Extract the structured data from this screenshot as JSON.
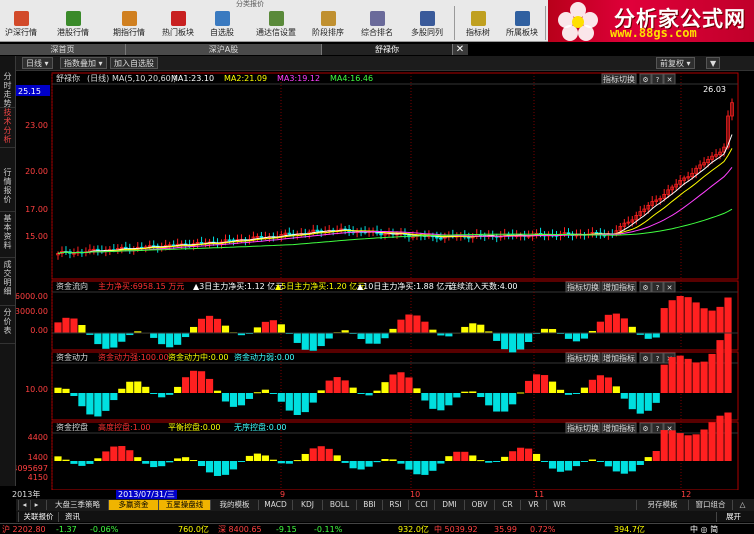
{
  "section_title": "分类报价",
  "toolbar": [
    {
      "label": "沪深行情",
      "color": "#d24a2a"
    },
    {
      "label": "港股行情",
      "color": "#3a8a2a"
    },
    {
      "label": "期指行情",
      "color": "#d08020"
    },
    {
      "label": "热门板块",
      "color": "#c82020"
    },
    {
      "label": "自选股",
      "color": "#3a7ac0"
    },
    {
      "label": "通达信设置",
      "color": "#5a8a3a"
    },
    {
      "label": "阶段排序",
      "color": "#c09030"
    },
    {
      "label": "综合排名",
      "color": "#6a6a9a"
    },
    {
      "label": "多股同列",
      "color": "#3a5a9a"
    },
    {
      "label": "指标树",
      "color": "#c0a020"
    },
    {
      "label": "所属板块",
      "color": "#3060a0"
    }
  ],
  "logo": {
    "main": "分析家公式网",
    "url": "www.88gs.com"
  },
  "tabs": [
    "深首页",
    "深沪A股",
    "舒禄你"
  ],
  "controls": {
    "period": "日线",
    "overlay": "指数叠加",
    "add_fav": "加入自选股",
    "restore": "前复权",
    "bars": "▼"
  },
  "sidebar": [
    {
      "label": "分时走势",
      "active": false
    },
    {
      "label": "技术分析",
      "active": true
    },
    {
      "label": "行情报价",
      "active": false
    },
    {
      "label": "基本资料",
      "active": false
    },
    {
      "label": "成交明细",
      "active": false
    },
    {
      "label": "分价表",
      "active": false
    }
  ],
  "panels": {
    "main": {
      "stock": "舒禄你",
      "period": "(日线)",
      "ma_label": "MA(5,10,20,60,)",
      "ma": [
        {
          "name": "MA1",
          "value": "23.10",
          "color": "#ffffff"
        },
        {
          "name": "MA2",
          "value": "21.09",
          "color": "#ffff00"
        },
        {
          "name": "MA3",
          "value": "19.12",
          "color": "#ff40ff"
        },
        {
          "name": "MA4",
          "value": "16.46",
          "color": "#40ff40"
        }
      ],
      "switch": "指标切换",
      "current": "25.15",
      "high": "26.03"
    },
    "flow": {
      "name": "资金流向",
      "items": [
        {
          "label": "主力净买:6958.15 万元",
          "color": "#ff3030"
        },
        {
          "label": "▲3日主力净买:1.12  亿元",
          "color": "#ffffff"
        },
        {
          "label": "▲5日主力净买:1.20  亿元",
          "color": "#ffff00"
        },
        {
          "label": "▲10日主力净买:1.88  亿元",
          "color": "#ffffff"
        },
        {
          "label": "连续流入天数:4.00",
          "color": "#ffffff"
        }
      ],
      "switch": "指标切换",
      "add": "增加指标"
    },
    "power": {
      "name": "资金动力",
      "items": [
        {
          "label": "资金动力强:100.00",
          "color": "#ff3030"
        },
        {
          "label": "资金动力中:0.00",
          "color": "#ffff00"
        },
        {
          "label": "资金动力弱:0.00",
          "color": "#40ffff"
        }
      ],
      "switch": "指标切换",
      "add": "增加指标"
    },
    "control": {
      "name": "资金控盘",
      "items": [
        {
          "label": "高度控盘:1.00",
          "color": "#ff3030"
        },
        {
          "label": "平衡控盘:0.00",
          "color": "#ffff00"
        },
        {
          "label": "无序控盘:0.00",
          "color": "#40ffff"
        }
      ],
      "switch": "指标切换",
      "add": "增加指标"
    }
  },
  "yaxis": {
    "main": [
      "26.03",
      "23.00",
      "20.00",
      "17.00",
      "15.00"
    ],
    "flow": [
      "6000.00",
      "3000.00",
      "0.00",
      "-3000.00"
    ],
    "power": [
      "10.00"
    ],
    "control": [
      "4400",
      "1400",
      "4095697",
      "4150"
    ]
  },
  "dates": {
    "year": "2013年",
    "cursor": "2013/07/31/三",
    "months": [
      "8",
      "9",
      "10",
      "11",
      "12"
    ]
  },
  "bottom_tabs": [
    {
      "label": "大盘三季策略",
      "orange": false
    },
    {
      "label": "多赢资金",
      "orange": true
    },
    {
      "label": "五星操盘线",
      "orange": true
    },
    {
      "label": "我的模板",
      "orange": false
    },
    {
      "label": "MACD",
      "orange": false
    },
    {
      "label": "KDJ",
      "orange": false
    },
    {
      "label": "BOLL",
      "orange": false
    },
    {
      "label": "BBI",
      "orange": false
    },
    {
      "label": "RSI",
      "orange": false
    },
    {
      "label": "CCI",
      "orange": false
    },
    {
      "label": "DMI",
      "orange": false
    },
    {
      "label": "OBV",
      "orange": false
    },
    {
      "label": "CR",
      "orange": false
    },
    {
      "label": "VR",
      "orange": false
    },
    {
      "label": "WR",
      "orange": false
    }
  ],
  "bottom_right": [
    "另存模板",
    "窗口组合",
    "△"
  ],
  "row2": [
    "关联报价",
    "资讯"
  ],
  "row2_right": "展开",
  "status": [
    {
      "text": "沪 2202.80",
      "color": "#ff4040"
    },
    {
      "text": "-1.37",
      "color": "#40ff40"
    },
    {
      "text": "-0.06%",
      "color": "#40ff40"
    },
    {
      "text": "760.0亿",
      "color": "#ffff00"
    },
    {
      "text": "深 8400.65",
      "color": "#ff4040"
    },
    {
      "text": "-9.15",
      "color": "#40ff40"
    },
    {
      "text": "-0.11%",
      "color": "#40ff40"
    },
    {
      "text": "932.0亿",
      "color": "#ffff00"
    },
    {
      "text": "中 5039.92",
      "color": "#ff4040"
    },
    {
      "text": "35.99",
      "color": "#ff4040"
    },
    {
      "text": "0.72%",
      "color": "#ff4040"
    },
    {
      "text": "394.7亿",
      "color": "#ffff00"
    },
    {
      "text": "中 ◎ 简",
      "color": "#ffffff"
    }
  ],
  "colors": {
    "up": "#ff2020",
    "down": "#00e0e0",
    "mid": "#ffff00",
    "grid": "#7a0000",
    "axis": "#b00000"
  }
}
